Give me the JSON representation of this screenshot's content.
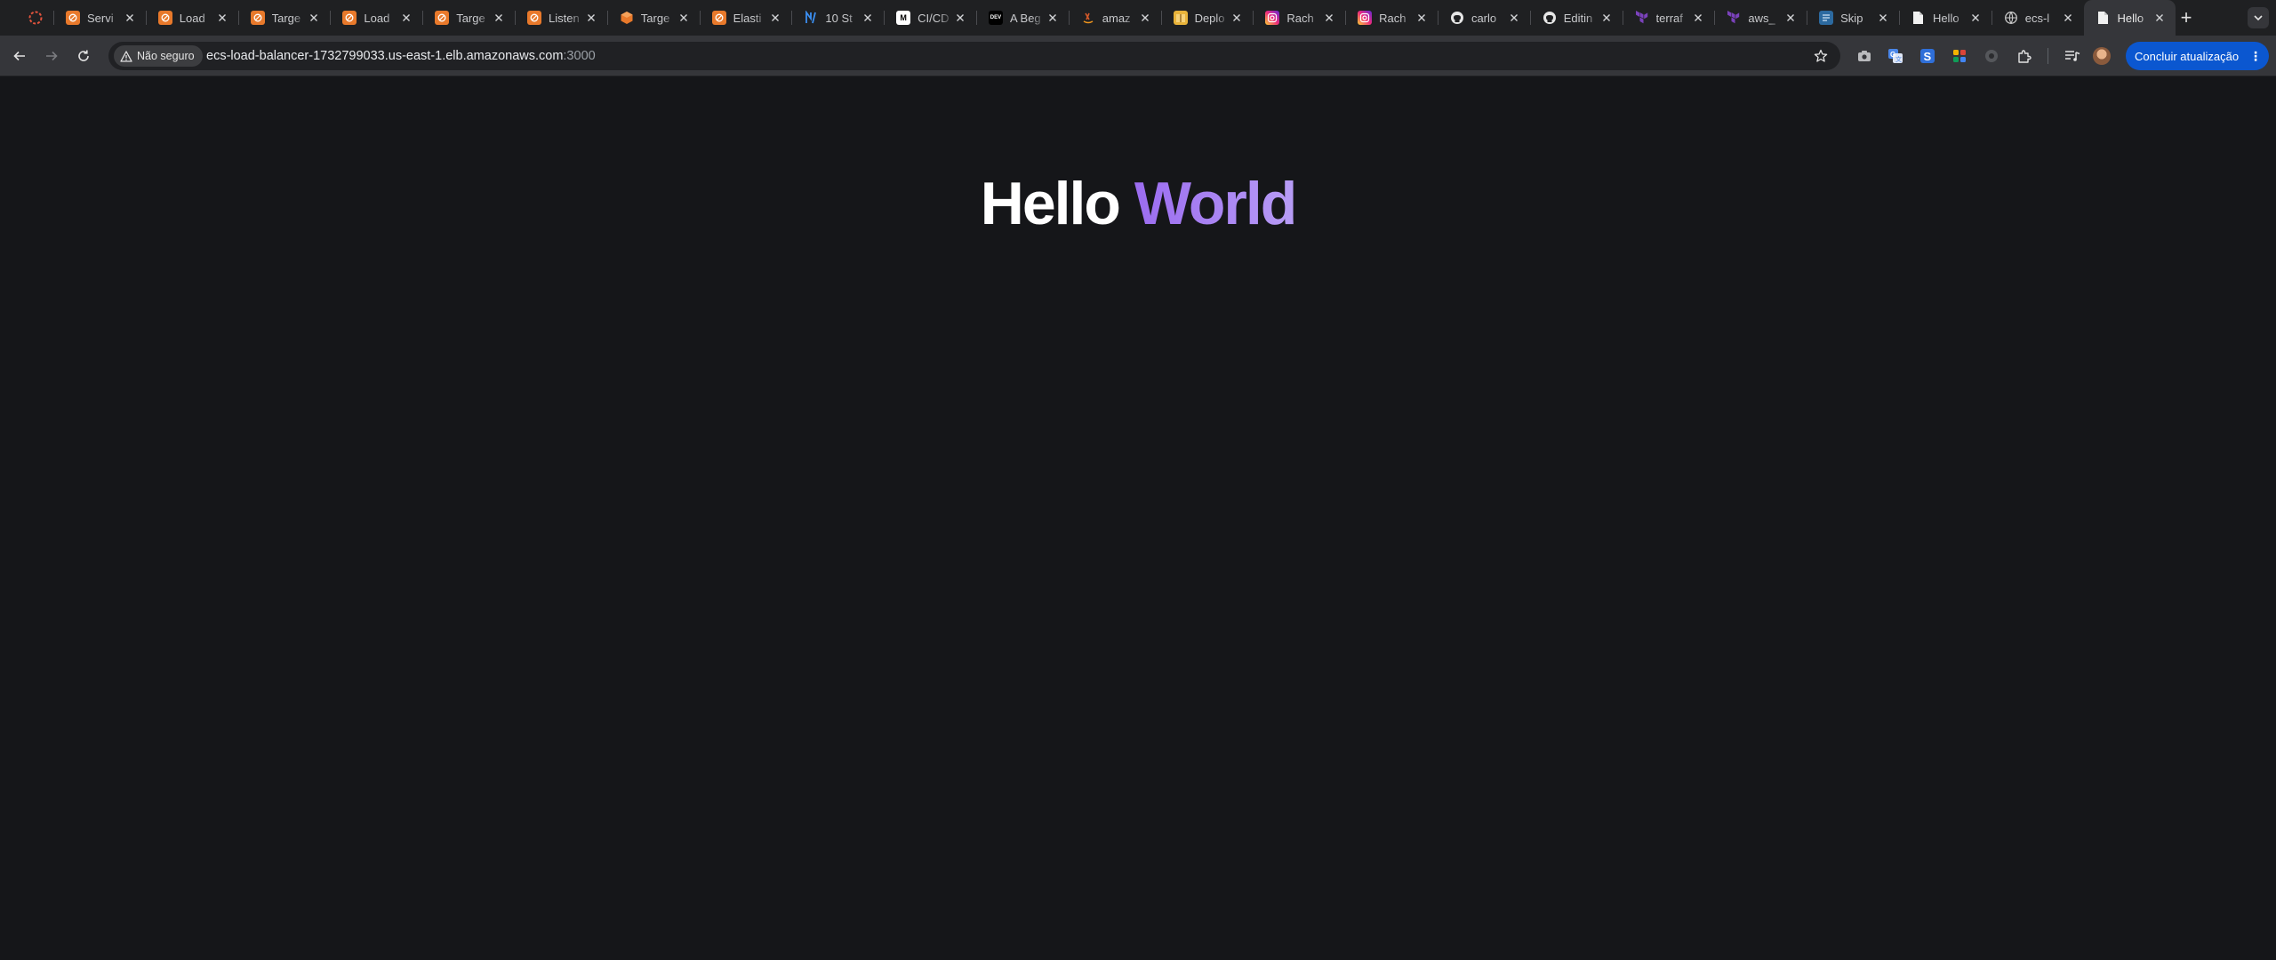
{
  "browser": {
    "tabs": [
      {
        "title": "Servi",
        "favicon": "aws-console-icon"
      },
      {
        "title": "Load",
        "favicon": "aws-console-icon"
      },
      {
        "title": "Targe",
        "favicon": "aws-console-icon"
      },
      {
        "title": "Load",
        "favicon": "aws-console-icon"
      },
      {
        "title": "Targe",
        "favicon": "aws-console-icon"
      },
      {
        "title": "Listen",
        "favicon": "aws-console-icon"
      },
      {
        "title": "Targe",
        "favicon": "aws-ec2-icon"
      },
      {
        "title": "Elasti",
        "favicon": "aws-console-icon"
      },
      {
        "title": "10 St",
        "favicon": "blue-logo-icon"
      },
      {
        "title": "CI/CD",
        "favicon": "medium-icon"
      },
      {
        "title": "A Beg",
        "favicon": "dev-to-icon"
      },
      {
        "title": "amaz",
        "favicon": "amazon-icon"
      },
      {
        "title": "Deplo",
        "favicon": "package-icon"
      },
      {
        "title": "Rach",
        "favicon": "instagram-icon"
      },
      {
        "title": "Rach",
        "favicon": "instagram-icon"
      },
      {
        "title": "carlo",
        "favicon": "github-icon"
      },
      {
        "title": "Editin",
        "favicon": "github-icon"
      },
      {
        "title": "terraf",
        "favicon": "terraform-icon"
      },
      {
        "title": "aws_",
        "favicon": "terraform-icon"
      },
      {
        "title": "Skip",
        "favicon": "docs-icon"
      },
      {
        "title": "Hello",
        "favicon": "page-icon"
      },
      {
        "title": "ecs-l",
        "favicon": "globe-icon"
      },
      {
        "title": "Hello",
        "favicon": "page-icon",
        "active": true
      }
    ],
    "new_tab_label": "+",
    "toolbar": {
      "security_label": "Não seguro",
      "url_host": "ecs-load-balancer-1732799033.us-east-1.elb.amazonaws.com",
      "url_port": ":3000",
      "update_button_label": "Concluir atualização"
    }
  },
  "page": {
    "heading_word_1": "Hello",
    "heading_word_2": "World"
  },
  "colors": {
    "page_background": "#151619",
    "heading_white": "#ffffff",
    "heading_accent": "#a98ff0",
    "update_button": "#0b57d0"
  }
}
